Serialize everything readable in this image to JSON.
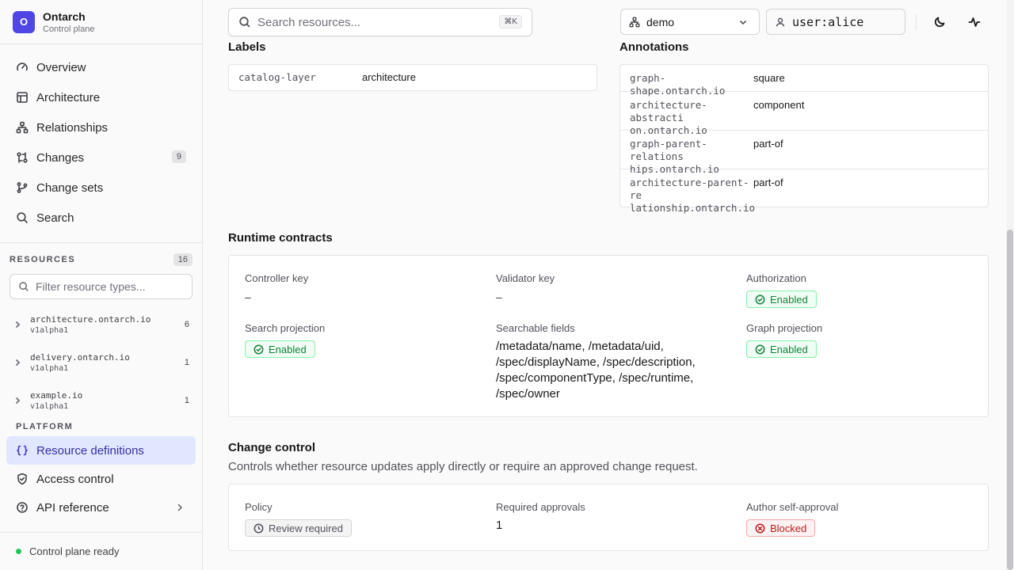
{
  "brand": {
    "name": "Ontarch",
    "subtitle": "Control plane",
    "logo_letter": "O",
    "color": "#4f46e5"
  },
  "nav": {
    "items": [
      {
        "label": "Overview",
        "icon": "gauge-icon"
      },
      {
        "label": "Architecture",
        "icon": "layout-icon"
      },
      {
        "label": "Relationships",
        "icon": "network-icon"
      },
      {
        "label": "Changes",
        "icon": "git-compare-icon",
        "badge": "9"
      },
      {
        "label": "Change sets",
        "icon": "git-branch-icon"
      },
      {
        "label": "Search",
        "icon": "search-icon"
      }
    ]
  },
  "resources": {
    "title": "RESOURCES",
    "count": "16",
    "filter_placeholder": "Filter resource types...",
    "groups": [
      {
        "name": "architecture.ontarch.io",
        "version": "v1alpha1",
        "count": "6"
      },
      {
        "name": "delivery.ontarch.io",
        "version": "v1alpha1",
        "count": "1"
      },
      {
        "name": "example.io",
        "version": "v1alpha1",
        "count": "1"
      }
    ]
  },
  "platform": {
    "title": "PLATFORM",
    "items": [
      {
        "label": "Resource definitions",
        "icon": "braces-icon",
        "active": true
      },
      {
        "label": "Access control",
        "icon": "shield-icon"
      },
      {
        "label": "API reference",
        "icon": "help-circle-icon"
      }
    ]
  },
  "status": {
    "text": "Control plane ready",
    "color": "#22c55e"
  },
  "topbar": {
    "search_placeholder": "Search resources...",
    "shortcut": "⌘K",
    "namespace": "demo",
    "user": "user:alice"
  },
  "labels": {
    "title": "Labels",
    "rows": [
      {
        "key": "catalog-layer",
        "value": "architecture"
      }
    ]
  },
  "annotations": {
    "title": "Annotations",
    "rows": [
      {
        "key_lines": [
          "graph-shape.ontarch.io"
        ],
        "value": "square"
      },
      {
        "key_lines": [
          "architecture-abstracti",
          "on.ontarch.io"
        ],
        "value": "component"
      },
      {
        "key_lines": [
          "graph-parent-relations",
          "hips.ontarch.io"
        ],
        "value": "part-of"
      },
      {
        "key_lines": [
          "architecture-parent-re",
          "lationship.ontarch.io"
        ],
        "value": "part-of"
      }
    ]
  },
  "runtime": {
    "title": "Runtime contracts",
    "controller_key": {
      "label": "Controller key",
      "value": "–"
    },
    "validator_key": {
      "label": "Validator key",
      "value": "–"
    },
    "authorization": {
      "label": "Authorization",
      "status": "Enabled"
    },
    "search_projection": {
      "label": "Search projection",
      "status": "Enabled"
    },
    "searchable_fields": {
      "label": "Searchable fields",
      "lines": [
        "/metadata/name, /metadata/uid,",
        "/spec/displayName, /spec/description,",
        "/spec/componentType, /spec/runtime,",
        "/spec/owner"
      ]
    },
    "graph_projection": {
      "label": "Graph projection",
      "status": "Enabled"
    }
  },
  "change_control": {
    "title": "Change control",
    "description": "Controls whether resource updates apply directly or require an approved change request.",
    "policy": {
      "label": "Policy",
      "status": "Review required"
    },
    "required_approvals": {
      "label": "Required approvals",
      "value": "1"
    },
    "self_approval": {
      "label": "Author self-approval",
      "status": "Blocked"
    }
  }
}
